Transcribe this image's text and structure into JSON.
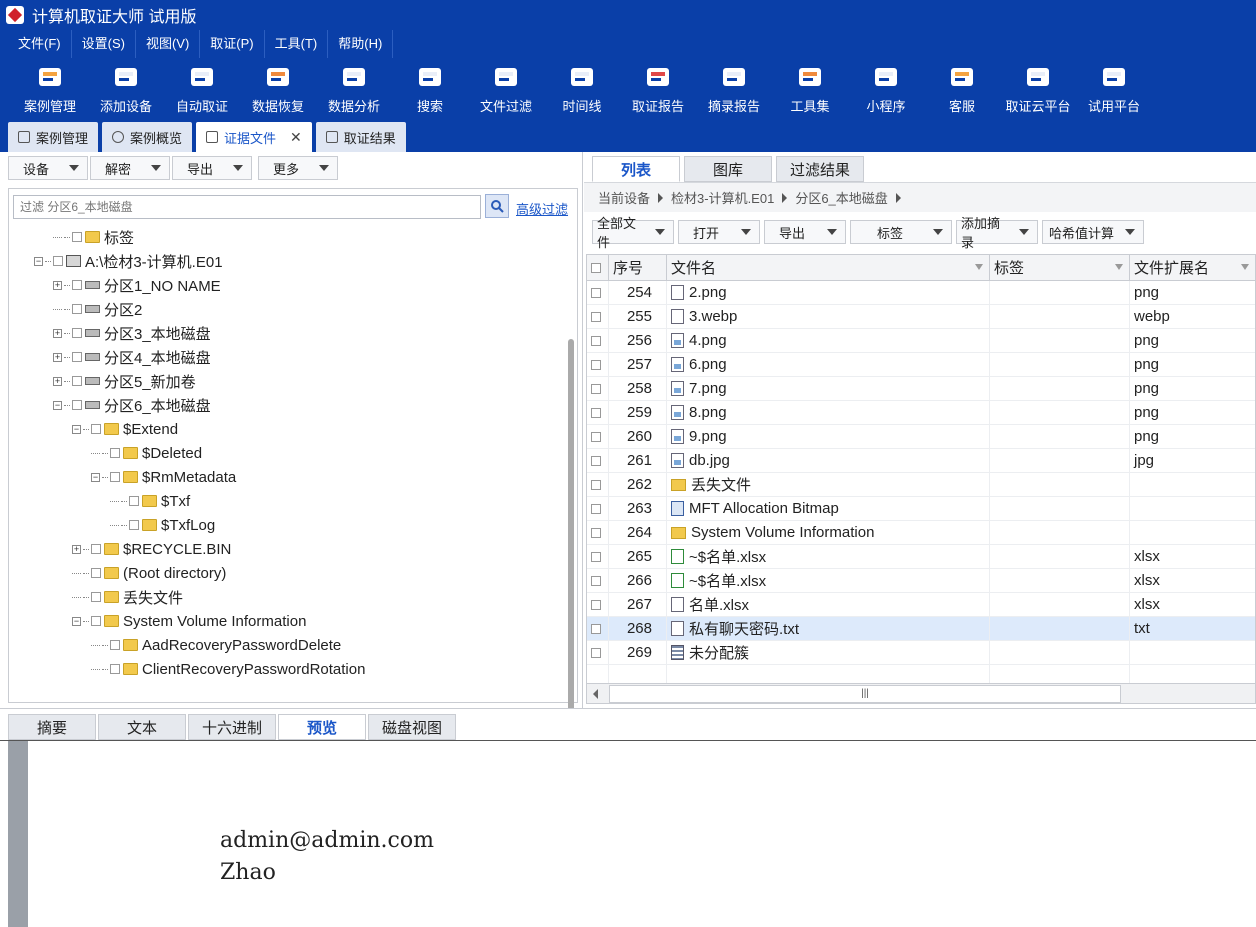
{
  "app": {
    "title": "计算机取证大师 试用版"
  },
  "menu": [
    "文件(F)",
    "设置(S)",
    "视图(V)",
    "取证(P)",
    "工具(T)",
    "帮助(H)"
  ],
  "toolbar": [
    {
      "label": "案例管理",
      "icon": "case-icon"
    },
    {
      "label": "添加设备",
      "icon": "add-device-icon"
    },
    {
      "label": "自动取证",
      "icon": "auto-icon"
    },
    {
      "label": "数据恢复",
      "icon": "recovery-icon"
    },
    {
      "label": "数据分析",
      "icon": "analysis-icon"
    },
    {
      "label": "搜索",
      "icon": "search-doc-icon"
    },
    {
      "label": "文件过滤",
      "icon": "filter-icon"
    },
    {
      "label": "时间线",
      "icon": "timeline-icon"
    },
    {
      "label": "取证报告",
      "icon": "report-icon"
    },
    {
      "label": "摘录报告",
      "icon": "excerpt-icon"
    },
    {
      "label": "工具集",
      "icon": "toolkit-icon"
    },
    {
      "label": "小程序",
      "icon": "miniapp-icon"
    },
    {
      "label": "客服",
      "icon": "support-icon"
    },
    {
      "label": "取证云平台",
      "icon": "cloud-icon"
    },
    {
      "label": "试用平台",
      "icon": "trial-icon"
    }
  ],
  "doc_tabs": [
    {
      "label": "案例管理",
      "active": false,
      "closable": false
    },
    {
      "label": "案例概览",
      "active": false,
      "closable": false
    },
    {
      "label": "证据文件",
      "active": true,
      "closable": true
    },
    {
      "label": "取证结果",
      "active": false,
      "closable": false
    }
  ],
  "left_buttons": [
    "设备",
    "解密",
    "导出",
    "更多"
  ],
  "filter": {
    "placeholder": "过滤 分区6_本地磁盘",
    "advanced": "高级过滤"
  },
  "tree": [
    {
      "label": "标签",
      "depth": 2,
      "expander": "",
      "icon": "folder"
    },
    {
      "label": "A:\\检材3-计算机.E01",
      "depth": 1,
      "expander": "-",
      "icon": "hdd"
    },
    {
      "label": "分区1_NO NAME",
      "depth": 2,
      "expander": "+",
      "icon": "disk"
    },
    {
      "label": "分区2",
      "depth": 2,
      "expander": "",
      "icon": "disk"
    },
    {
      "label": "分区3_本地磁盘",
      "depth": 2,
      "expander": "+",
      "icon": "disk"
    },
    {
      "label": "分区4_本地磁盘",
      "depth": 2,
      "expander": "+",
      "icon": "disk"
    },
    {
      "label": "分区5_新加卷",
      "depth": 2,
      "expander": "+",
      "icon": "disk"
    },
    {
      "label": "分区6_本地磁盘",
      "depth": 2,
      "expander": "-",
      "icon": "disk"
    },
    {
      "label": "$Extend",
      "depth": 3,
      "expander": "-",
      "icon": "folder"
    },
    {
      "label": "$Deleted",
      "depth": 4,
      "expander": "",
      "icon": "folder"
    },
    {
      "label": "$RmMetadata",
      "depth": 4,
      "expander": "-",
      "icon": "folder"
    },
    {
      "label": "$Txf",
      "depth": 5,
      "expander": "",
      "icon": "folder"
    },
    {
      "label": "$TxfLog",
      "depth": 5,
      "expander": "",
      "icon": "folder"
    },
    {
      "label": "$RECYCLE.BIN",
      "depth": 3,
      "expander": "+",
      "icon": "folder"
    },
    {
      "label": "(Root directory)",
      "depth": 3,
      "expander": "",
      "icon": "folder"
    },
    {
      "label": "丢失文件",
      "depth": 3,
      "expander": "",
      "icon": "folder"
    },
    {
      "label": "System Volume Information",
      "depth": 3,
      "expander": "-",
      "icon": "folder"
    },
    {
      "label": "AadRecoveryPasswordDelete",
      "depth": 4,
      "expander": "",
      "icon": "folder"
    },
    {
      "label": "ClientRecoveryPasswordRotation",
      "depth": 4,
      "expander": "",
      "icon": "folder"
    }
  ],
  "right_tabs": [
    {
      "label": "列表",
      "active": true
    },
    {
      "label": "图库",
      "active": false
    },
    {
      "label": "过滤结果",
      "active": false
    }
  ],
  "breadcrumb": [
    "当前设备",
    "检材3-计算机.E01",
    "分区6_本地磁盘"
  ],
  "right_buttons": [
    "全部文件",
    "打开",
    "导出",
    "标签",
    "添加摘录",
    "哈希值计算"
  ],
  "table": {
    "headers": [
      "序号",
      "文件名",
      "标签",
      "文件扩展名"
    ],
    "rows": [
      {
        "no": "254",
        "name": "2.png",
        "tag": "",
        "ext": "png",
        "icon": "file"
      },
      {
        "no": "255",
        "name": "3.webp",
        "tag": "",
        "ext": "webp",
        "icon": "file"
      },
      {
        "no": "256",
        "name": "4.png",
        "tag": "",
        "ext": "png",
        "icon": "image"
      },
      {
        "no": "257",
        "name": "6.png",
        "tag": "",
        "ext": "png",
        "icon": "image"
      },
      {
        "no": "258",
        "name": "7.png",
        "tag": "",
        "ext": "png",
        "icon": "image"
      },
      {
        "no": "259",
        "name": "8.png",
        "tag": "",
        "ext": "png",
        "icon": "image"
      },
      {
        "no": "260",
        "name": "9.png",
        "tag": "",
        "ext": "png",
        "icon": "image"
      },
      {
        "no": "261",
        "name": "db.jpg",
        "tag": "",
        "ext": "jpg",
        "icon": "image"
      },
      {
        "no": "262",
        "name": "丢失文件",
        "tag": "",
        "ext": "",
        "icon": "folder"
      },
      {
        "no": "263",
        "name": "MFT Allocation Bitmap",
        "tag": "",
        "ext": "",
        "icon": "mft"
      },
      {
        "no": "264",
        "name": "System Volume Information",
        "tag": "",
        "ext": "",
        "icon": "folder"
      },
      {
        "no": "265",
        "name": "~$名单.xlsx",
        "tag": "",
        "ext": "xlsx",
        "icon": "excel"
      },
      {
        "no": "266",
        "name": "~$名单.xlsx",
        "tag": "",
        "ext": "xlsx",
        "icon": "excel"
      },
      {
        "no": "267",
        "name": "名单.xlsx",
        "tag": "",
        "ext": "xlsx",
        "icon": "file"
      },
      {
        "no": "268",
        "name": "私有聊天密码.txt",
        "tag": "",
        "ext": "txt",
        "icon": "file",
        "selected": true
      },
      {
        "no": "269",
        "name": "未分配簇",
        "tag": "",
        "ext": "",
        "icon": "unalloc"
      }
    ]
  },
  "bottom_tabs": [
    {
      "label": "摘要",
      "active": false
    },
    {
      "label": "文本",
      "active": false
    },
    {
      "label": "十六进制",
      "active": false
    },
    {
      "label": "预览",
      "active": true
    },
    {
      "label": "磁盘视图",
      "active": false
    }
  ],
  "preview": {
    "lines": [
      "admin@admin.com",
      "Zhao"
    ]
  }
}
